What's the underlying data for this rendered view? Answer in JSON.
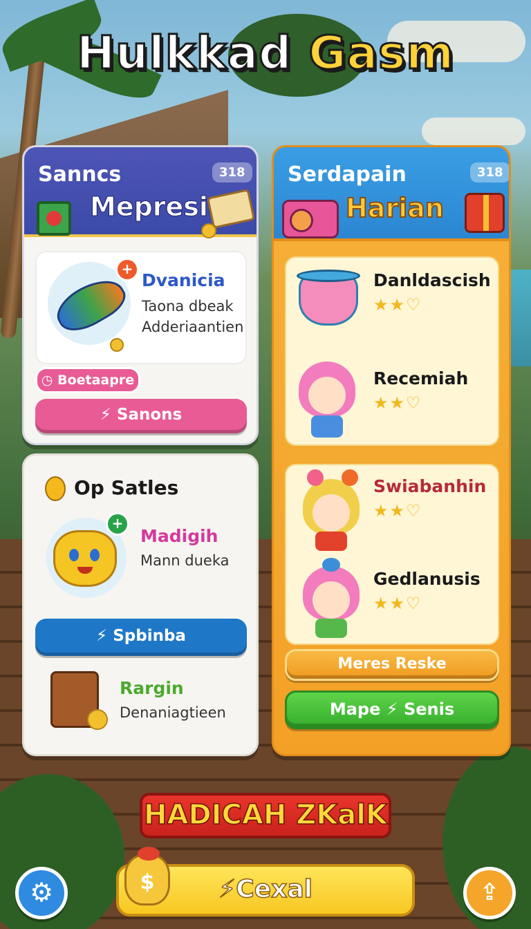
{
  "game_title": {
    "part1": "Hulkkad",
    "part2": "Gasm"
  },
  "left_panel": {
    "header_sub": "Sanncs",
    "header_main": "Mepresia",
    "header_badge": "318",
    "item": {
      "title": "Dvanicia",
      "line1": "Taona dbeak",
      "line2": "Adderiaantien"
    },
    "pill_label": "Boetaapre",
    "button_label": "Sanons"
  },
  "left_bottom_panel": {
    "header": "Op Satles",
    "item": {
      "title": "Madigih",
      "text": "Mann dueka"
    },
    "button_label": "Spbinba",
    "item2": {
      "title": "Rargin",
      "text": "Denaniagtieen"
    }
  },
  "right_panel": {
    "header_sub": "Serdapain",
    "header_main": "Harian",
    "header_badge": "318",
    "items": [
      {
        "name": "Danldascish",
        "stars": "★★♡"
      },
      {
        "name": "Recemiah",
        "stars": "★★♡"
      },
      {
        "name": "Swiabanhin",
        "stars": "★★♡"
      },
      {
        "name": "Gedlanusis",
        "stars": "★★♡"
      }
    ],
    "more_button": "Meres Reske",
    "green_button": {
      "left": "Mape",
      "right": "Senis"
    }
  },
  "banner": "HADICAH ZKalK",
  "main_button": "Cexal",
  "icons": {
    "settings": "gear-icon",
    "upload": "upload-icon",
    "lightning": "bolt-icon"
  },
  "colors": {
    "blue_header": "#4e55b5",
    "orange_panel": "#f3a126",
    "pink_button": "#e85b94",
    "blue_button": "#1f77c8",
    "green_button": "#3fc23a",
    "yellow_button": "#f7c721",
    "red_banner": "#d8281f"
  }
}
